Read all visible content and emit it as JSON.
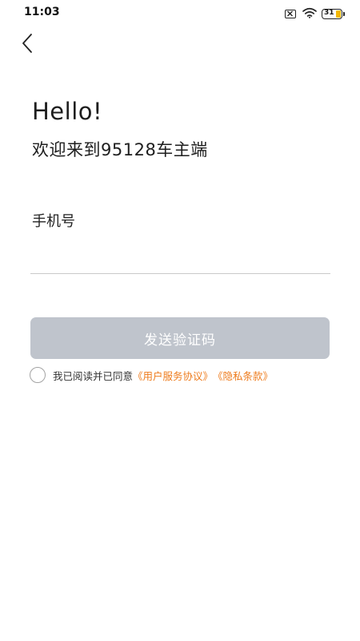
{
  "status_bar": {
    "time": "11:03",
    "battery_level": "31",
    "icons": [
      "sim-off-icon",
      "wifi-icon",
      "battery-icon"
    ]
  },
  "navigation": {
    "back_icon": "chevron-left-icon"
  },
  "greeting": {
    "title": "Hello!",
    "subtitle": "欢迎来到95128车主端"
  },
  "phone_field": {
    "label": "手机号",
    "value": "",
    "placeholder": ""
  },
  "send_code_button": {
    "label": "发送验证码",
    "state": "disabled"
  },
  "agreement": {
    "checked": false,
    "prefix": "我已阅读并已同意",
    "user_agreement_link": "《用户服务协议》",
    "privacy_link": "《隐私条款》"
  },
  "colors": {
    "button_disabled": "#bfc4cc",
    "link": "#ee7b1c",
    "text": "#1e1e1e",
    "battery": "#f5b800"
  }
}
